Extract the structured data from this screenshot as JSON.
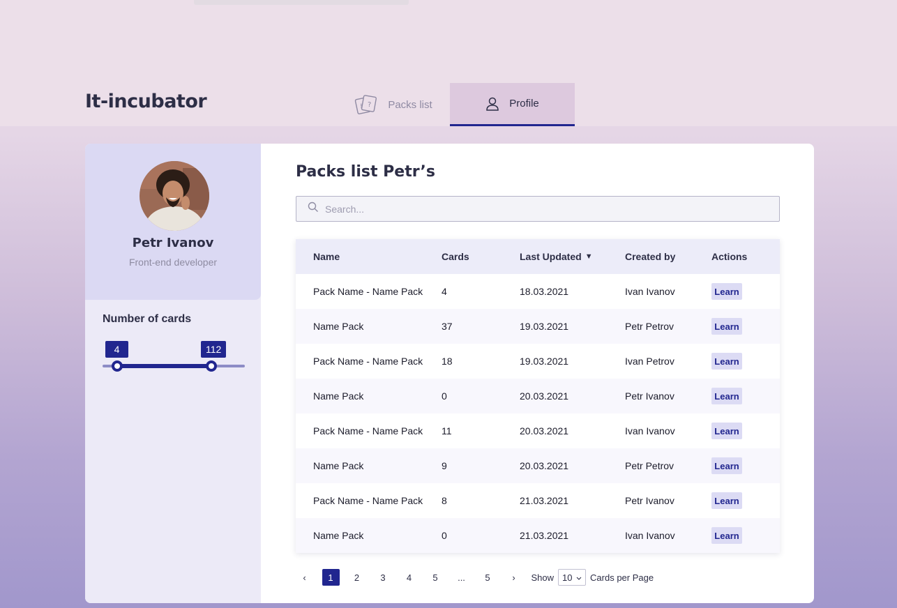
{
  "header": {
    "logo": "It-incubator",
    "tabs": [
      {
        "label": "Packs list",
        "icon": "cards-icon",
        "active": false
      },
      {
        "label": "Profile",
        "icon": "user-icon",
        "active": true
      }
    ]
  },
  "profile": {
    "name": "Petr Ivanov",
    "role": "Front-end developer"
  },
  "cards_filter": {
    "title": "Number of cards",
    "min_value": "4",
    "max_value": "112"
  },
  "main": {
    "title": "Packs list Petr’s",
    "search_placeholder": "Search..."
  },
  "table": {
    "headers": {
      "name": "Name",
      "cards": "Cards",
      "last_updated": "Last Updated",
      "created_by": "Created by",
      "actions": "Actions"
    },
    "sort_indicator": "▼",
    "rows": [
      {
        "name": "Pack Name - Name Pack",
        "cards": "4",
        "updated": "18.03.2021",
        "created_by": "Ivan Ivanov",
        "action": "Learn"
      },
      {
        "name": "Name Pack",
        "cards": "37",
        "updated": "19.03.2021",
        "created_by": "Petr Petrov",
        "action": "Learn"
      },
      {
        "name": "Pack Name - Name Pack",
        "cards": "18",
        "updated": "19.03.2021",
        "created_by": "Ivan Petrov",
        "action": "Learn"
      },
      {
        "name": "Name Pack",
        "cards": "0",
        "updated": "20.03.2021",
        "created_by": "Petr Ivanov",
        "action": "Learn"
      },
      {
        "name": "Pack Name - Name Pack",
        "cards": "11",
        "updated": "20.03.2021",
        "created_by": "Ivan Ivanov",
        "action": "Learn"
      },
      {
        "name": "Name Pack",
        "cards": "9",
        "updated": "20.03.2021",
        "created_by": "Petr Petrov",
        "action": "Learn"
      },
      {
        "name": "Pack Name - Name Pack",
        "cards": "8",
        "updated": "21.03.2021",
        "created_by": "Petr Ivanov",
        "action": "Learn"
      },
      {
        "name": "Name Pack",
        "cards": "0",
        "updated": "21.03.2021",
        "created_by": "Ivan Ivanov",
        "action": "Learn"
      }
    ]
  },
  "pagination": {
    "prev": "‹",
    "pages": [
      "1",
      "2",
      "3",
      "4",
      "5",
      "...",
      "5"
    ],
    "active_page": "1",
    "next": "›",
    "show_label": "Show",
    "per_page_value": "10",
    "per_page_label": "Cards per Page"
  },
  "colors": {
    "accent": "#21268f",
    "learn_bg": "#dcdbf4",
    "profile_bg": "#dbd9f3"
  }
}
